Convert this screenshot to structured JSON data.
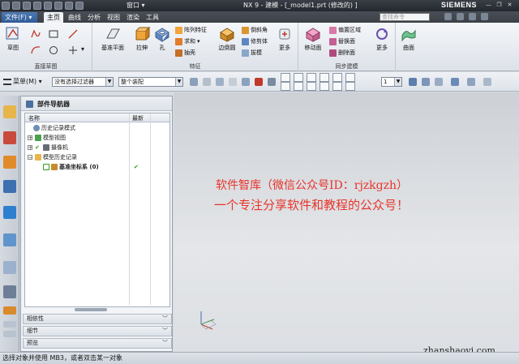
{
  "titlebar": {
    "window_menu": "窗口 ▾",
    "title": "NX 9 - 建模 - [_model1.prt  (修改的) ]",
    "brand": "SIEMENS"
  },
  "tabs": [
    {
      "label": "文件(F) ▾"
    },
    {
      "label": "主页"
    },
    {
      "label": "曲线"
    },
    {
      "label": "分析"
    },
    {
      "label": "视图"
    },
    {
      "label": "渲染"
    },
    {
      "label": "工具"
    }
  ],
  "search": {
    "placeholder": "查找命令"
  },
  "ribbon": {
    "sketch_label": "草图",
    "group_direct_sketch": "直接草图",
    "datum_plane": "基准平面",
    "extrude": "拉伸",
    "hole": "孔",
    "pattern_feature": "阵列特征",
    "unite": "求和",
    "shell": "抽壳",
    "edge_blend": "边倒圆",
    "chamfer": "倒斜角",
    "trim_body": "修剪体",
    "draft": "拔模",
    "more1": "更多",
    "group_feature": "特征",
    "move_face": "移动面",
    "offset_region": "偏置区域",
    "replace_face": "替换面",
    "delete_face": "删除面",
    "more2": "更多",
    "surface": "曲面",
    "group_sync": "同步建模"
  },
  "toolbar": {
    "menu": "菜单(M) ▾",
    "filter": "没有选择过滤器",
    "assembly": "整个装配",
    "spin_value": "1"
  },
  "navigator": {
    "title": "部件导航器",
    "col_name": "名称",
    "col_latest": "最新",
    "rows": [
      {
        "label": "历史记录模式"
      },
      {
        "label": "模型视图"
      },
      {
        "label": "摄像机"
      },
      {
        "label": "模型历史记录"
      },
      {
        "label": "基准坐标系 (0)"
      }
    ],
    "check_mark": "✔",
    "accordions": [
      {
        "label": "相依性"
      },
      {
        "label": "细节"
      },
      {
        "label": "预览"
      }
    ]
  },
  "watermark": {
    "line1": "软件智库（微信公众号ID：rjzkgzh）",
    "line2": "一个专注分享软件和教程的公众号！",
    "site": "zhanshaoyi.com"
  },
  "status": {
    "text": "选择对象并使用 MB3，或者双击某一对象"
  },
  "colors": {
    "accent": "#2f5b97",
    "watermark_red": "#e8342a",
    "check_green": "#2d9c1e"
  }
}
